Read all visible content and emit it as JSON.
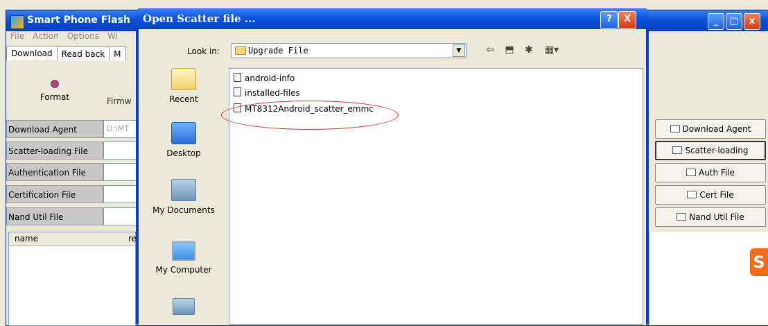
{
  "app": {
    "title": "Smart Phone Flash",
    "menu": [
      "File",
      "Action",
      "Options",
      "Wi"
    ],
    "tabs": [
      "Download",
      "Read back",
      "M"
    ],
    "toolbar": {
      "format_label": "Format",
      "firmware_label": "Firmw"
    },
    "fields": [
      {
        "label": "Download Agent",
        "value": "D:\\MT"
      },
      {
        "label": "Scatter-loading File",
        "value": ""
      },
      {
        "label": "Authentication File",
        "value": ""
      },
      {
        "label": "Certification File",
        "value": ""
      },
      {
        "label": "Nand Util File",
        "value": ""
      }
    ],
    "side_buttons": [
      "Download Agent",
      "Scatter-loading",
      "Auth File",
      "Cert File",
      "Nand Util File"
    ],
    "list_columns": [
      "name",
      "re"
    ],
    "logo_letter": "S"
  },
  "dialog": {
    "title": "Open Scatter file ...",
    "help_label": "?",
    "close_label": "X",
    "look_in_label": "Look in:",
    "look_in_value": "Upgrade File",
    "places": [
      "Recent",
      "Desktop",
      "My Documents",
      "My Computer"
    ],
    "files": [
      "android-info",
      "installed-files",
      "MT8312Android_scatter_emmc"
    ],
    "annotation_color": "#d42a2a"
  },
  "colors": {
    "titlebar": "#0a4fd6",
    "face": "#ece9d8"
  }
}
